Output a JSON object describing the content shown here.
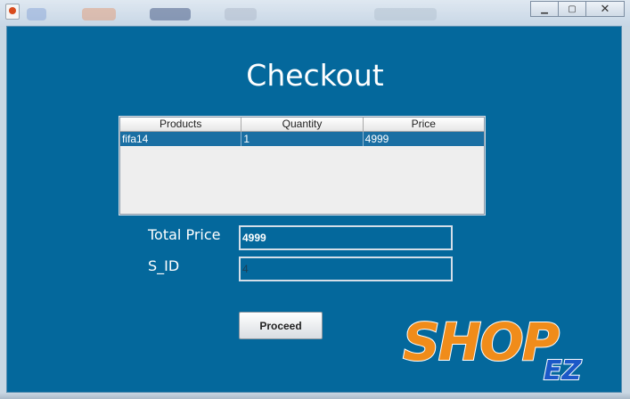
{
  "window": {
    "minimize_glyph": "▁",
    "maximize_glyph": "▢",
    "close_glyph": "✕"
  },
  "colors": {
    "panel": "#04689c",
    "selected_row": "#1a6fa3",
    "logo_orange": "#f08c1a",
    "logo_blue": "#1b58c8"
  },
  "page": {
    "title": "Checkout"
  },
  "table": {
    "headers": [
      "Products",
      "Quantity",
      "Price"
    ],
    "rows": [
      [
        "fifa14",
        "1",
        "4999"
      ]
    ]
  },
  "form": {
    "total_price_label": "Total Price",
    "total_price_value": "4999",
    "sid_label": "S_ID",
    "sid_value": "4"
  },
  "actions": {
    "proceed_label": "Proceed"
  },
  "logo": {
    "text_main": "SHOP",
    "text_sub": "EZ"
  }
}
